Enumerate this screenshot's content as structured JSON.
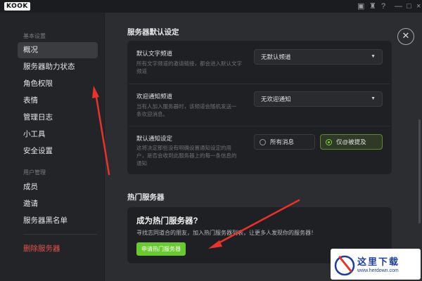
{
  "titlebar": {
    "logo": "KOOK"
  },
  "sidebar": {
    "section_basic": "基本设置",
    "items_basic": [
      {
        "label": "概况",
        "active": true
      },
      {
        "label": "服务器助力状态"
      },
      {
        "label": "角色权限"
      },
      {
        "label": "表情"
      },
      {
        "label": "管理日志"
      },
      {
        "label": "小工具"
      },
      {
        "label": "安全设置"
      }
    ],
    "section_user": "用户管理",
    "items_user": [
      {
        "label": "成员"
      },
      {
        "label": "邀请"
      },
      {
        "label": "服务器黑名单"
      }
    ],
    "delete_label": "删除服务器"
  },
  "main": {
    "defaults_title": "服务器默认设定",
    "rows": [
      {
        "title": "默认文字频道",
        "desc_line1": "所有文字频道的邀请链接，都会进入默认文字",
        "desc_line2": "频道",
        "select": "无默认频道"
      },
      {
        "title": "欢迎通知频道",
        "desc_line1": "当有人加入服务器时，该频道会随机发送一",
        "desc_line2": "条欢迎消息。",
        "select": "无欢迎通知"
      },
      {
        "title": "默认通知设定",
        "desc_line1": "这将决定那些没有明确设置通知设定的用",
        "desc_line2": "户，是否会收到此服务器上的每一条信息的",
        "desc_line3": "通知",
        "option_all": "所有消息",
        "option_mention": "仅@被提及"
      }
    ],
    "hot_title": "热门服务器",
    "promo_title": "成为热门服务器?",
    "promo_desc": "寻找志同道合的朋友，加入热门服务器列表，让更多人发现你的服务器！",
    "apply_button": "申请热门服务器"
  },
  "watermark": {
    "text": "这里下载",
    "url": "www.herdown.com"
  },
  "colors": {
    "accent": "#69c92e",
    "danger": "#e0544c",
    "arrow": "#e8322a"
  }
}
